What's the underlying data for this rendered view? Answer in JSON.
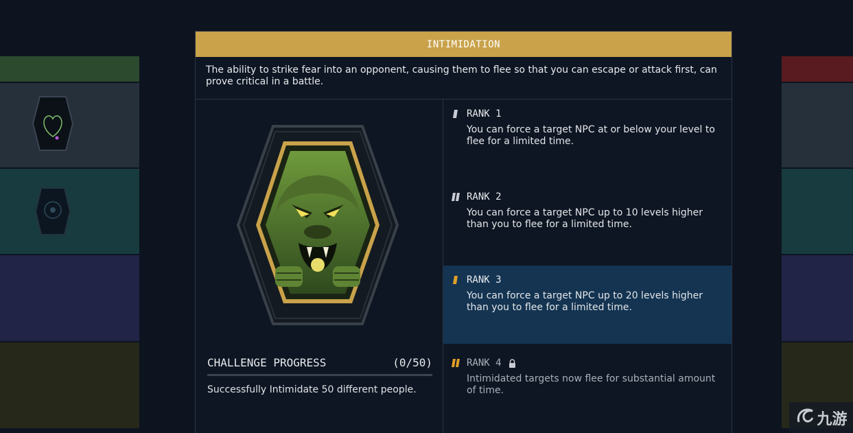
{
  "perk": {
    "title": "INTIMIDATION",
    "description": "The ability to strike fear into an opponent, causing them to flee so that you can escape or attack first, can prove critical in a battle.",
    "badge_icon": "gorilla-patch-icon"
  },
  "challenge": {
    "label": "CHALLENGE PROGRESS",
    "progress_text": "(0/50)",
    "progress_fraction": 0,
    "description": "Successfully Intimidate 50 different people."
  },
  "ranks": [
    {
      "label": "RANK 1",
      "description": "You can force a target NPC at or below your level to flee for a limited time.",
      "locked": false,
      "selected": false
    },
    {
      "label": "RANK 2",
      "description": "You can force a target NPC up to 10 levels higher than you to flee for a limited time.",
      "locked": false,
      "selected": false
    },
    {
      "label": "RANK 3",
      "description": "You can force a target NPC up to 20 levels higher than you to flee for a limited time.",
      "locked": false,
      "selected": true
    },
    {
      "label": "RANK 4",
      "description": "Intimidated targets now flee for substantial amount of time.",
      "locked": true,
      "selected": false
    }
  ],
  "watermark": {
    "text": "九游"
  },
  "colors": {
    "accent_gold": "#c9a24a",
    "selected_row": "#143452",
    "panel_bg": "#0e1624"
  }
}
